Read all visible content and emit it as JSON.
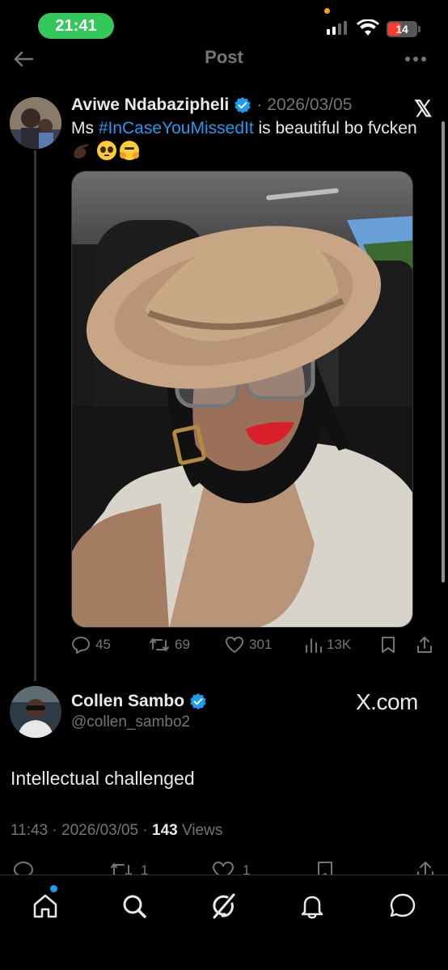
{
  "status_bar": {
    "time": "21:41",
    "battery_level": "14",
    "icons": [
      "signal-icon",
      "wifi-icon",
      "battery-icon"
    ]
  },
  "header": {
    "title": "Post",
    "back_icon": "arrow-left-icon",
    "more_icon": "more-dots-icon"
  },
  "quoted_post": {
    "display_name": "Aviwe Ndabazipheli",
    "separator": "·",
    "date": "2026/03/05",
    "text_prefix": "Ms ",
    "hashtag": "#InCaseYouMissedIt",
    "text_suffix": " is beautiful bo fvcken",
    "emojis": [
      "pinching-hand-emoji",
      "pleading-face-emoji",
      "hugging-face-emoji"
    ],
    "stats": {
      "replies": "45",
      "reposts": "69",
      "likes": "301",
      "views": "13K"
    }
  },
  "main_post": {
    "display_name": "Collen Sambo",
    "handle": "@collen_sambo2",
    "brand": "X.com",
    "text": "Intellectual challenged",
    "time": "11:43",
    "date": "2026/03/05",
    "separator": "·",
    "views_count": "143",
    "views_label": "Views",
    "reposts": "1",
    "likes": "1"
  },
  "bottom_nav": {
    "items": [
      "home-icon",
      "search-icon",
      "grok-icon",
      "notifications-icon",
      "messages-icon"
    ]
  },
  "colors": {
    "background": "#000000",
    "accent": "#1d9bf0",
    "muted": "#71767b",
    "text": "#e7e9ea",
    "time_pill": "#34c759"
  }
}
